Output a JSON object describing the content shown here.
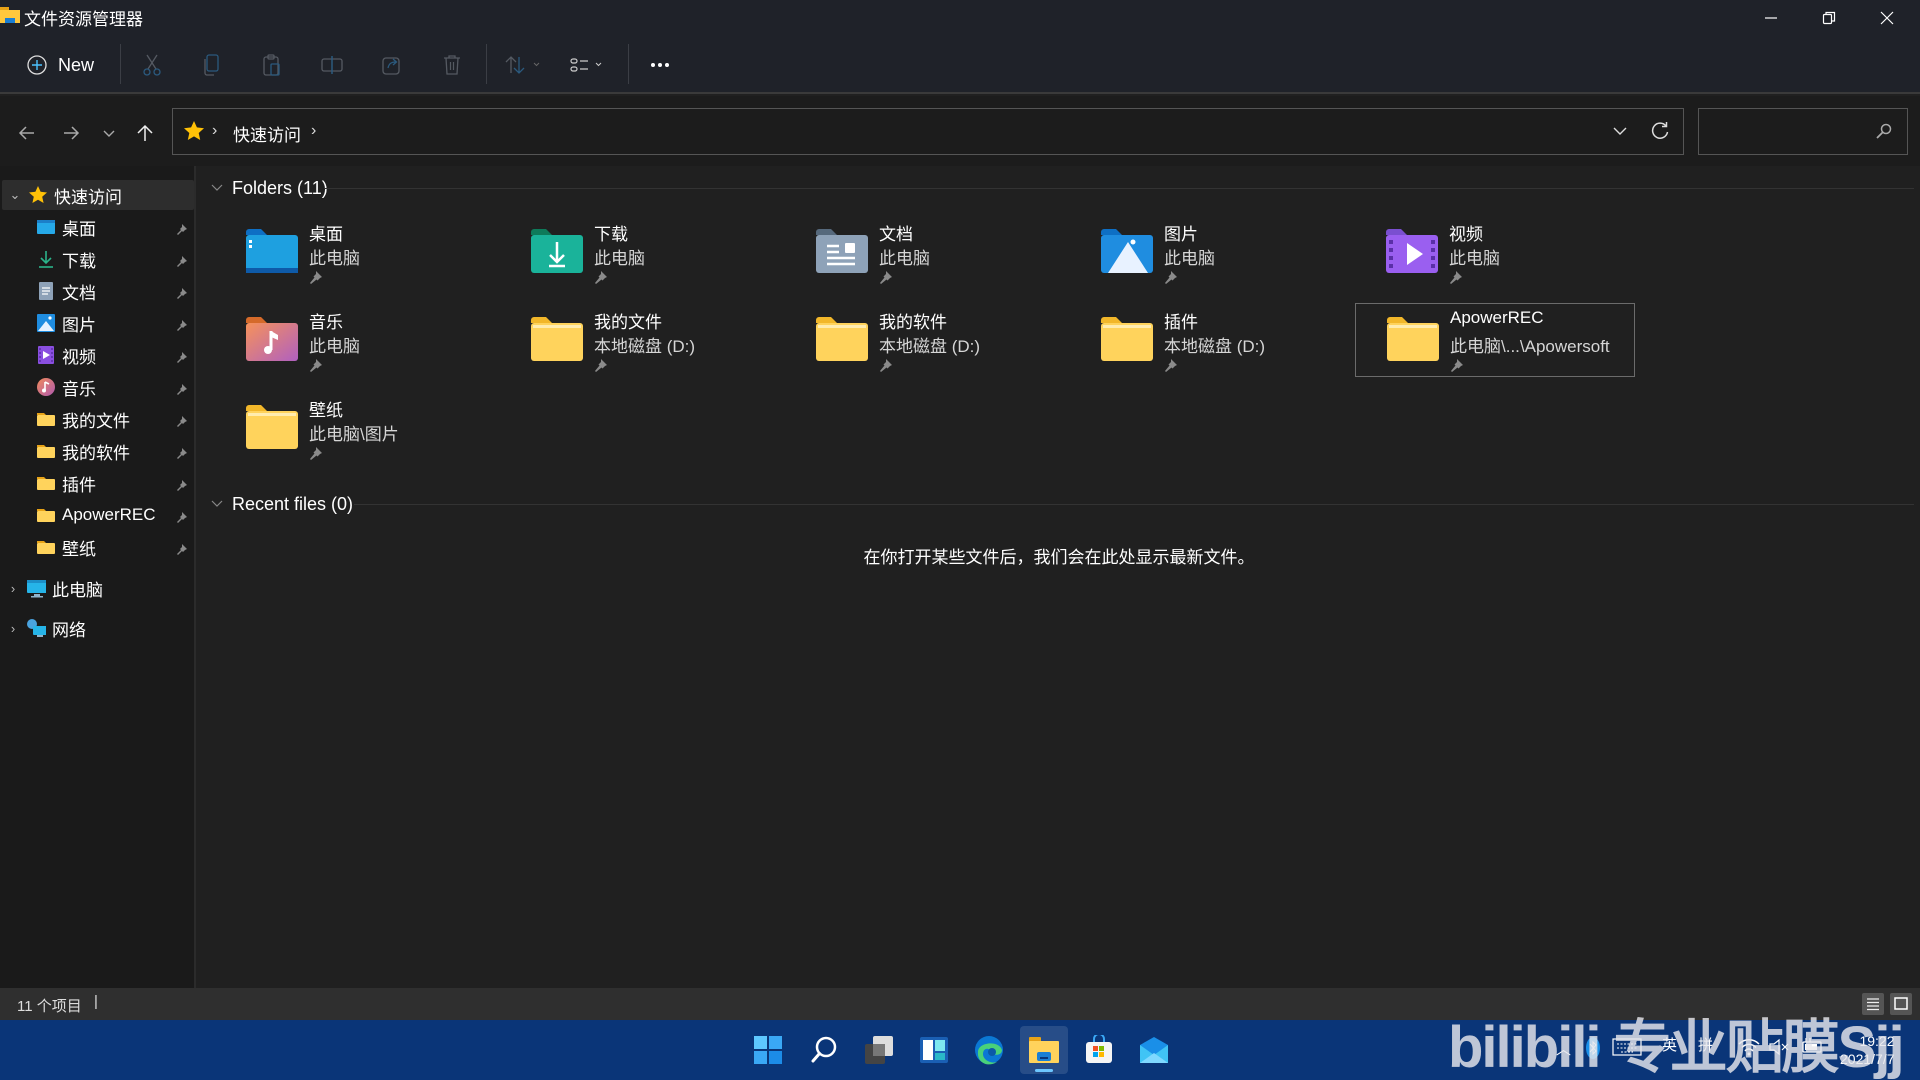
{
  "window": {
    "title": "文件资源管理器",
    "controls": {
      "minimize": "—",
      "restore": "❐",
      "close": "✕"
    }
  },
  "toolbar": {
    "new_label": "New",
    "icons": [
      "cut-icon",
      "copy-icon",
      "paste-icon",
      "rename-icon",
      "share-icon",
      "delete-icon",
      "sort-icon",
      "view-icon",
      "more-icon"
    ]
  },
  "navigation": {
    "breadcrumb": [
      "快速访问"
    ],
    "search_placeholder": ""
  },
  "sidebar": {
    "quick_access": {
      "label": "快速访问",
      "expanded": true
    },
    "items": [
      {
        "label": "桌面",
        "icon": "desktop-icon",
        "pinned": true
      },
      {
        "label": "下载",
        "icon": "download-icon",
        "pinned": true
      },
      {
        "label": "文档",
        "icon": "documents-icon",
        "pinned": true
      },
      {
        "label": "图片",
        "icon": "pictures-icon",
        "pinned": true
      },
      {
        "label": "视频",
        "icon": "videos-icon",
        "pinned": true
      },
      {
        "label": "音乐",
        "icon": "music-icon",
        "pinned": true
      },
      {
        "label": "我的文件",
        "icon": "folder-icon",
        "pinned": true
      },
      {
        "label": "我的软件",
        "icon": "folder-icon",
        "pinned": true
      },
      {
        "label": "插件",
        "icon": "folder-icon",
        "pinned": true
      },
      {
        "label": "ApowerREC",
        "icon": "folder-icon",
        "pinned": true
      },
      {
        "label": "壁纸",
        "icon": "folder-icon",
        "pinned": true
      }
    ],
    "this_pc": "此电脑",
    "network": "网络"
  },
  "content": {
    "folders_header": "Folders (11)",
    "folders": [
      {
        "name": "桌面",
        "location": "此电脑",
        "icon": "desktop-folder-icon"
      },
      {
        "name": "下载",
        "location": "此电脑",
        "icon": "downloads-folder-icon"
      },
      {
        "name": "文档",
        "location": "此电脑",
        "icon": "documents-folder-icon"
      },
      {
        "name": "图片",
        "location": "此电脑",
        "icon": "pictures-folder-icon"
      },
      {
        "name": "视频",
        "location": "此电脑",
        "icon": "videos-folder-icon"
      },
      {
        "name": "音乐",
        "location": "此电脑",
        "icon": "music-folder-icon"
      },
      {
        "name": "我的文件",
        "location": "本地磁盘 (D:)",
        "icon": "folder-icon"
      },
      {
        "name": "我的软件",
        "location": "本地磁盘 (D:)",
        "icon": "folder-icon"
      },
      {
        "name": "插件",
        "location": "本地磁盘 (D:)",
        "icon": "folder-icon"
      },
      {
        "name": "ApowerREC",
        "location": "此电脑\\...\\Apowersoft",
        "icon": "folder-icon",
        "selected": true
      },
      {
        "name": "壁纸",
        "location": "此电脑\\图片",
        "icon": "folder-icon"
      }
    ],
    "recent_header": "Recent files (0)",
    "recent_empty_message": "在你打开某些文件后，我们会在此处显示最新文件。"
  },
  "statusbar": {
    "item_count": "11 个项目",
    "separator": "|"
  },
  "taskbar": {
    "apps": [
      "start-icon",
      "search-icon",
      "task-view-icon",
      "widgets-icon",
      "edge-icon",
      "file-explorer-icon",
      "store-icon",
      "mail-icon"
    ],
    "active_app": "file-explorer-icon",
    "tray": {
      "ime_lang": "英",
      "ime_mode": "拼"
    },
    "time": "19:22",
    "date": "2021/7/7"
  },
  "watermark": "bilibili 专业贴膜Sjj",
  "colors": {
    "accent": "#4cc2ff",
    "folder_yellow": "#ffd35c",
    "taskbar": "#0a3578"
  }
}
